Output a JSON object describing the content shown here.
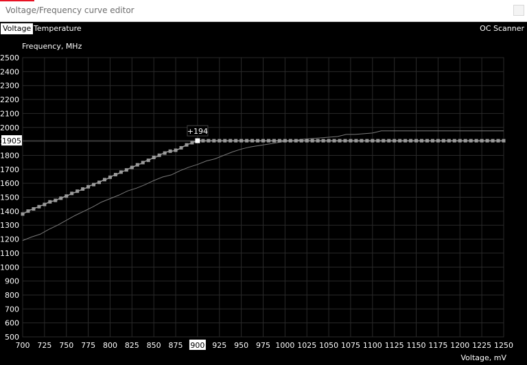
{
  "window": {
    "title": "Voltage/Frequency curve editor"
  },
  "tabs": [
    {
      "label": "Voltage",
      "active": true
    },
    {
      "label": "Temperature",
      "active": false
    }
  ],
  "actions": {
    "oc_scanner": "OC Scanner"
  },
  "colors": {
    "background": "#000000",
    "grid": "#2a2a2a",
    "curve": "#9a9a9a",
    "baseline": "#7a7a7a",
    "selected": "#ffffff"
  },
  "chart_data": {
    "type": "line",
    "xlabel": "Voltage, mV",
    "ylabel": "Frequency, MHz",
    "xlim": [
      700,
      1250
    ],
    "ylim": [
      500,
      2500
    ],
    "x_ticks": [
      700,
      725,
      750,
      775,
      800,
      825,
      850,
      875,
      900,
      925,
      950,
      975,
      1000,
      1025,
      1050,
      1075,
      1100,
      1125,
      1150,
      1175,
      1200,
      1225,
      1250
    ],
    "y_ticks": [
      500,
      600,
      700,
      800,
      900,
      1000,
      1100,
      1200,
      1300,
      1400,
      1500,
      1600,
      1700,
      1800,
      1900,
      2000,
      2100,
      2200,
      2300,
      2400,
      2500
    ],
    "grid": true,
    "highlight": {
      "x": 900,
      "y": 1905,
      "x_label": "900",
      "y_label": "1905",
      "offset_label": "+194"
    },
    "series": [
      {
        "role": "adjusted",
        "x": [
          700,
          703,
          706,
          709,
          712,
          715,
          718,
          721,
          724,
          727,
          730,
          733,
          736,
          739,
          742,
          745,
          748,
          751,
          754,
          757,
          760,
          763,
          766,
          769,
          772,
          775,
          778,
          781,
          784,
          787,
          790,
          793,
          796,
          799,
          802,
          805,
          808,
          811,
          814,
          817,
          820,
          823,
          826,
          829,
          832,
          835,
          838,
          841,
          844,
          847,
          850,
          853,
          856,
          859,
          862,
          865,
          868,
          871,
          874,
          877,
          880,
          883,
          886,
          889,
          892,
          895,
          898,
          900,
          950,
          1000,
          1050,
          1100,
          1150,
          1200,
          1250
        ],
        "y": [
          1380,
          1390,
          1400,
          1410,
          1415,
          1425,
          1430,
          1440,
          1445,
          1455,
          1465,
          1470,
          1475,
          1480,
          1490,
          1495,
          1505,
          1510,
          1520,
          1530,
          1535,
          1545,
          1550,
          1560,
          1565,
          1575,
          1585,
          1590,
          1600,
          1605,
          1615,
          1625,
          1630,
          1640,
          1650,
          1660,
          1665,
          1675,
          1685,
          1690,
          1700,
          1710,
          1715,
          1725,
          1735,
          1740,
          1750,
          1760,
          1765,
          1775,
          1785,
          1790,
          1800,
          1810,
          1815,
          1825,
          1830,
          1830,
          1835,
          1840,
          1850,
          1860,
          1870,
          1880,
          1885,
          1895,
          1900,
          1905,
          1905,
          1905,
          1905,
          1905,
          1905,
          1905,
          1905
        ]
      },
      {
        "role": "default",
        "x": [
          700,
          710,
          720,
          730,
          740,
          750,
          760,
          770,
          780,
          790,
          800,
          810,
          820,
          830,
          840,
          850,
          860,
          870,
          880,
          890,
          900,
          910,
          920,
          930,
          940,
          950,
          960,
          970,
          980,
          990,
          1000,
          1010,
          1020,
          1030,
          1040,
          1050,
          1060,
          1070,
          1080,
          1090,
          1100,
          1110,
          1120,
          1130,
          1140,
          1150,
          1200,
          1250
        ],
        "y": [
          1190,
          1215,
          1235,
          1270,
          1300,
          1335,
          1370,
          1400,
          1430,
          1465,
          1490,
          1515,
          1545,
          1565,
          1590,
          1620,
          1645,
          1660,
          1690,
          1715,
          1735,
          1760,
          1775,
          1800,
          1825,
          1845,
          1860,
          1870,
          1880,
          1890,
          1900,
          1905,
          1915,
          1920,
          1925,
          1930,
          1935,
          1950,
          1950,
          1955,
          1960,
          1975,
          1975,
          1975,
          1975,
          1975,
          1975,
          1975
        ]
      }
    ]
  }
}
